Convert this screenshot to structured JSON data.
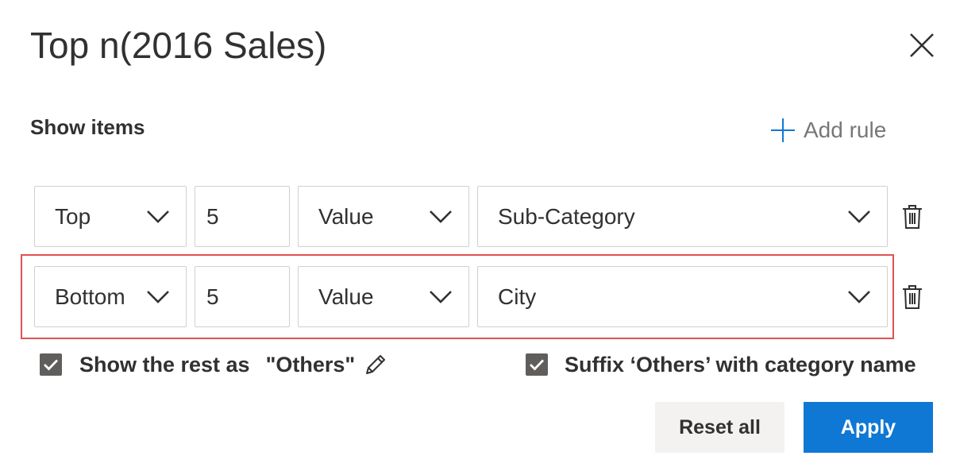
{
  "dialog": {
    "title": "Top n(2016 Sales)",
    "close_icon": "close-icon"
  },
  "section": {
    "label": "Show items",
    "add_rule_label": "Add rule",
    "add_icon": "plus-icon"
  },
  "rules": [
    {
      "direction": "Top",
      "count": "5",
      "measure": "Value",
      "field": "Sub-Category"
    },
    {
      "direction": "Bottom",
      "count": "5",
      "measure": "Value",
      "field": "City"
    }
  ],
  "options": {
    "show_rest": {
      "checked": true,
      "label": "Show the rest as",
      "value": "\"Others\""
    },
    "suffix_others": {
      "checked": true,
      "label": "Suffix ‘Others’ with category name"
    }
  },
  "buttons": {
    "reset_label": "Reset all",
    "apply_label": "Apply"
  },
  "colors": {
    "accent": "#0f78d4",
    "checkbox": "#605e5c",
    "highlight": "#e05252",
    "border": "#d2d0ce"
  }
}
